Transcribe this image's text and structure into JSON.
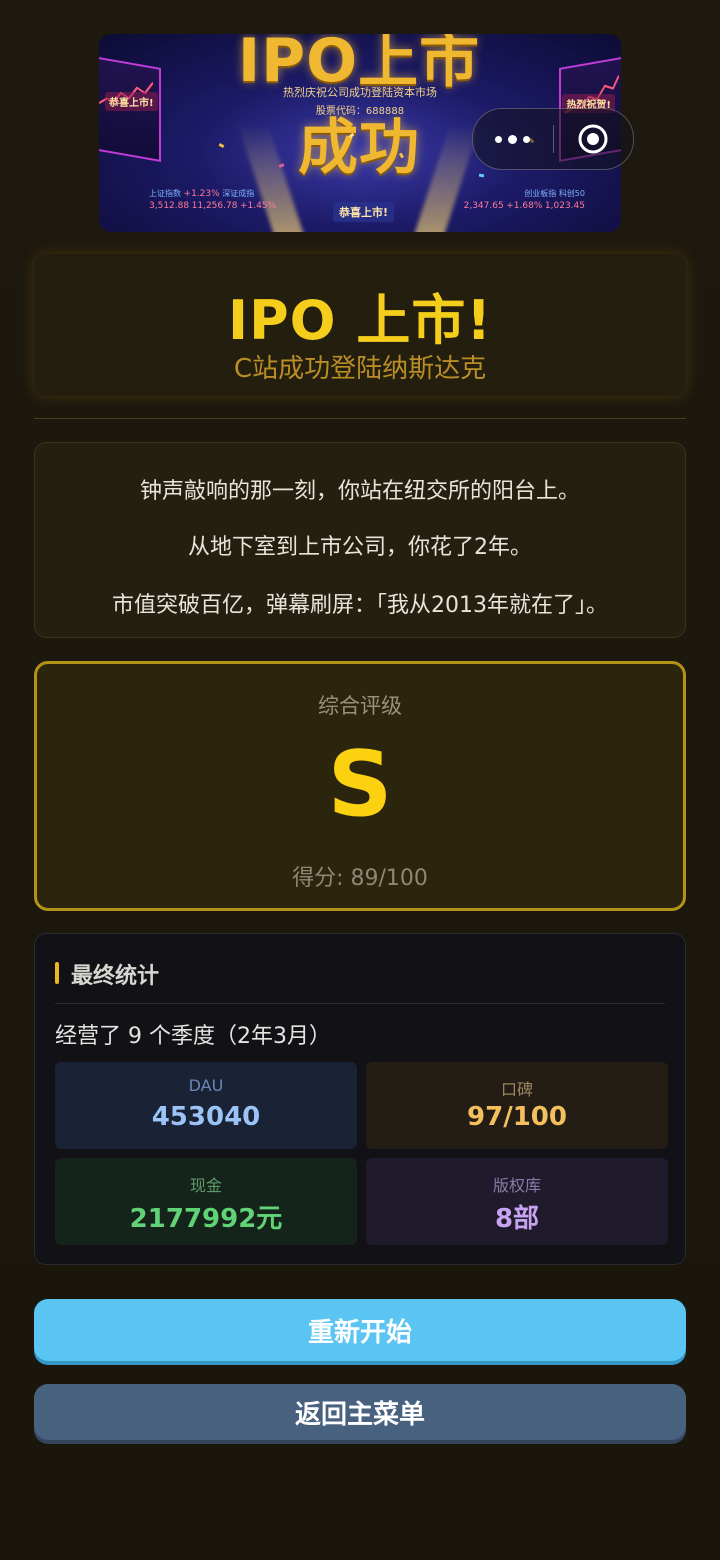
{
  "banner": {
    "headline": "IPO上市成功",
    "subline": "热烈庆祝公司成功登陆资本市场",
    "stock_code": "股票代码：688888",
    "left_tag": "恭喜上市!",
    "right_tag": "热烈祝贺!",
    "center_tag": "恭喜上市!",
    "ticker_left": [
      "上证指数",
      "3,512.88",
      "+1.23%",
      "深证成指",
      "11,256.78",
      "+1.45%"
    ],
    "ticker_right": [
      "创业板指",
      "2,347.65",
      "+1.68%",
      "科创50",
      "1,023.45"
    ]
  },
  "capsule": {
    "more_icon": "more-dots-icon",
    "close_icon": "target-close-icon"
  },
  "header": {
    "title": "IPO 上市!",
    "subtitle": "C站成功登陆纳斯达克"
  },
  "story": {
    "line1": "钟声敲响的那一刻，你站在纽交所的阳台上。",
    "line2": "从地下室到上市公司，你花了2年。",
    "line3": "市值突破百亿，弹幕刷屏：「我从2013年就在了」。"
  },
  "rating": {
    "label": "综合评级",
    "grade": "S",
    "score": "得分: 89/100"
  },
  "stats": {
    "heading": "最终统计",
    "duration": "经营了 9 个季度（2年3月）",
    "tiles": [
      {
        "label": "DAU",
        "value": "453040"
      },
      {
        "label": "口碑",
        "value": "97/100"
      },
      {
        "label": "现金",
        "value": "2177992元"
      },
      {
        "label": "版权库",
        "value": "8部"
      }
    ]
  },
  "buttons": {
    "restart": "重新开始",
    "main_menu": "返回主菜单"
  },
  "colors": {
    "accent_yellow": "#f5cd1b",
    "restart_blue": "#5ac4f3",
    "menu_slate": "#48617f",
    "background": "#1c170d"
  }
}
